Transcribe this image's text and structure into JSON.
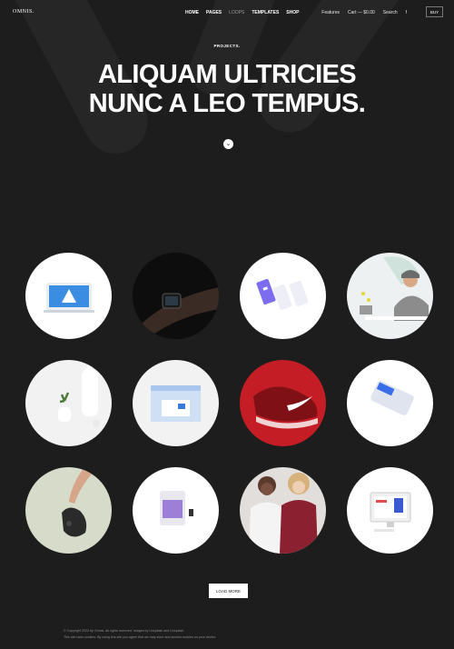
{
  "nav": {
    "logo": "OMNIS.",
    "menu": [
      {
        "label": "HOME"
      },
      {
        "label": "PAGES"
      },
      {
        "label": "LOOPS"
      },
      {
        "label": "TEMPLATES"
      },
      {
        "label": "SHOP"
      }
    ],
    "features": "Features",
    "cart": "Cart — $0.00",
    "search": "Search",
    "social_icon": "f",
    "buy": "BUY"
  },
  "hero": {
    "eyebrow": "PROJECTS.",
    "title_line1": "ALIQUAM ULTRICIES",
    "title_line2": "NUNC A LEO TEMPUS.",
    "scroll_icon": "chevron-down-icon"
  },
  "projects": [
    {
      "thumb": "laptop-logo-thumbnail"
    },
    {
      "thumb": "smartwatch-wrist-thumbnail"
    },
    {
      "thumb": "app-screens-thumbnail"
    },
    {
      "thumb": "man-at-desk-thumbnail"
    },
    {
      "thumb": "vase-plant-thumbnail"
    },
    {
      "thumb": "web-template-thumbnail"
    },
    {
      "thumb": "red-sneaker-thumbnail"
    },
    {
      "thumb": "phone-app-thumbnail"
    },
    {
      "thumb": "hand-gamepad-thumbnail"
    },
    {
      "thumb": "tablet-mockup-thumbnail"
    },
    {
      "thumb": "two-women-thumbnail"
    },
    {
      "thumb": "desktop-computer-thumbnail"
    }
  ],
  "load_more": "LOAD MORE",
  "footer": {
    "line1": "© Copyright 2022 by Omnis. All rights reserved. Images by Unsplash and Unsplash.",
    "line2": "This site uses cookies. By using this site you agree that we may store and access cookies on your device."
  },
  "colors": {
    "background": "#1d1d1d",
    "text": "#ffffff",
    "muted": "#9a9a9a",
    "accent_red": "#c41d25"
  }
}
